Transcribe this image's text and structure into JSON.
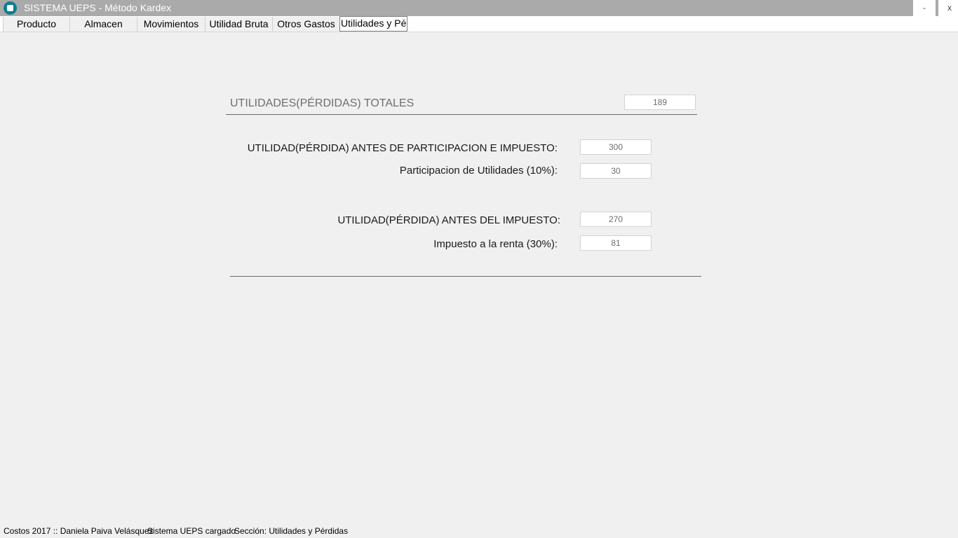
{
  "window": {
    "title": "SISTEMA UEPS - Método Kardex",
    "minimize": "-",
    "close": "x"
  },
  "tabs": [
    "Producto",
    "Almacen",
    "Movimientos",
    "Utilidad Bruta",
    "Otros Gastos",
    "Utilidades y Pér"
  ],
  "form": {
    "total_label": "UTILIDADES(PÉRDIDAS) TOTALES",
    "total_value": "189",
    "before_participation_label": "UTILIDAD(PÉRDIDA) ANTES DE PARTICIPACION E IMPUESTO:",
    "before_participation_value": "300",
    "participation_label": "Participacion de Utilidades (10%):",
    "participation_value": "30",
    "before_tax_label": "UTILIDAD(PÉRDIDA) ANTES DEL IMPUESTO:",
    "before_tax_value": "270",
    "tax_label": "Impuesto a la renta (30%):",
    "tax_value": "81"
  },
  "status": {
    "user": "Costos 2017 :: Daniela Paiva Velásquez",
    "system": "Sistema UEPS cargado",
    "section": "Sección: Utilidades y Pérdidas"
  }
}
